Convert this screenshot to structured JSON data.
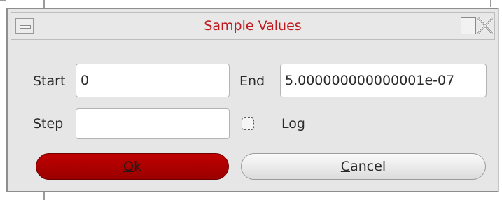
{
  "window": {
    "title": "Sample Values",
    "title_color": "#c0181c",
    "icons": {
      "menu": "window-menu-icon",
      "maximize": "maximize-icon",
      "close": "close-icon"
    }
  },
  "form": {
    "start": {
      "label": "Start",
      "value": "0"
    },
    "end": {
      "label": "End",
      "value": "5.000000000000001e-07"
    },
    "step": {
      "label": "Step",
      "value": ""
    },
    "log": {
      "label": "Log",
      "checked": false
    }
  },
  "buttons": {
    "ok": {
      "mnemonic": "O",
      "rest": "k",
      "color": "#b00000"
    },
    "cancel": {
      "mnemonic": "C",
      "rest": "ancel"
    }
  }
}
